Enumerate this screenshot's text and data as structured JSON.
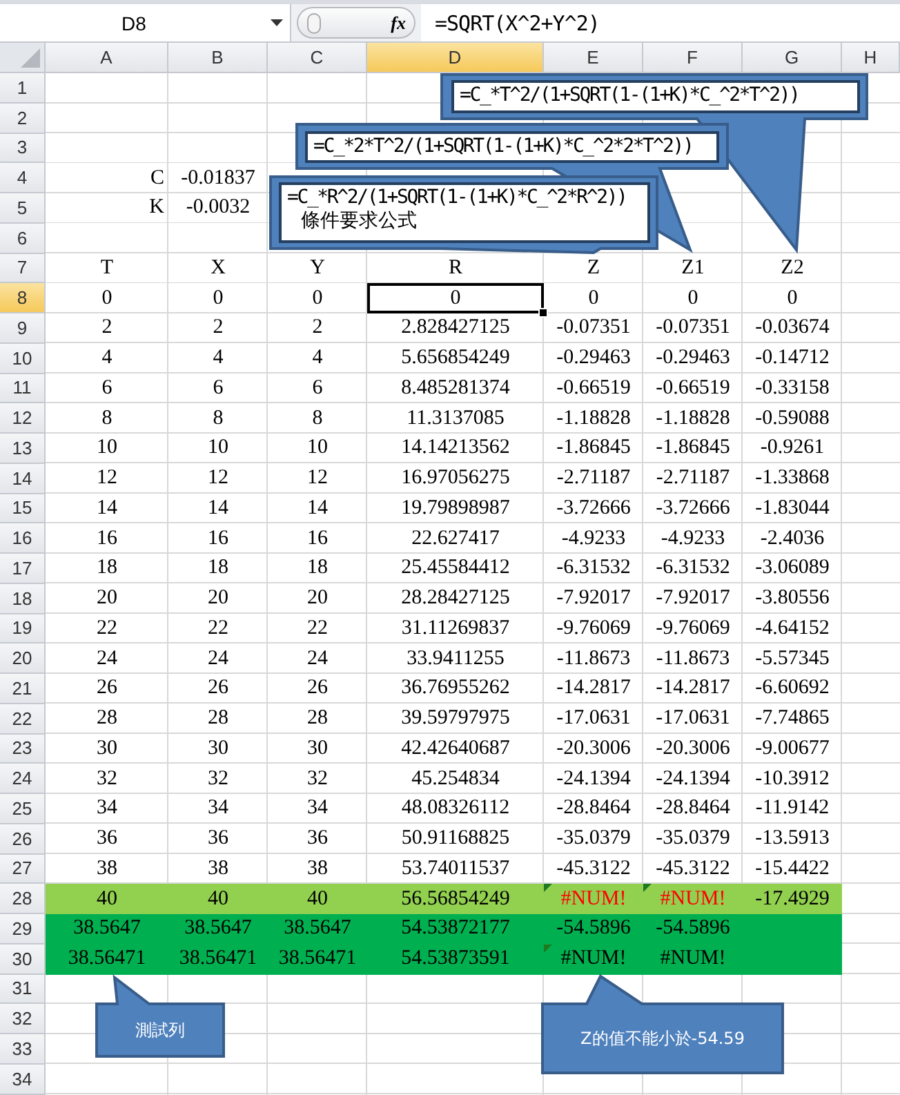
{
  "formula_bar": {
    "name_box": "D8",
    "function_button": "fx",
    "formula": "=SQRT(X^2+Y^2)"
  },
  "columns": [
    {
      "label": "A",
      "selected": false
    },
    {
      "label": "B",
      "selected": false
    },
    {
      "label": "C",
      "selected": false
    },
    {
      "label": "D",
      "selected": true
    },
    {
      "label": "E",
      "selected": false
    },
    {
      "label": "F",
      "selected": false
    },
    {
      "label": "G",
      "selected": false
    },
    {
      "label": "H",
      "selected": false
    }
  ],
  "rows": [
    {
      "number": "1",
      "selected": false,
      "cells": [
        null,
        null,
        null,
        null,
        null,
        null,
        null,
        null
      ]
    },
    {
      "number": "2",
      "selected": false,
      "cells": [
        null,
        null,
        null,
        null,
        null,
        null,
        null,
        null
      ]
    },
    {
      "number": "3",
      "selected": false,
      "cells": [
        null,
        null,
        null,
        null,
        null,
        null,
        null,
        null
      ]
    },
    {
      "number": "4",
      "selected": false,
      "cells": [
        {
          "text": "C",
          "kind": "label"
        },
        "-0.01837",
        null,
        null,
        null,
        null,
        null,
        null
      ]
    },
    {
      "number": "5",
      "selected": false,
      "cells": [
        {
          "text": "K",
          "kind": "label"
        },
        "-0.0032",
        null,
        null,
        null,
        null,
        null,
        null
      ]
    },
    {
      "number": "6",
      "selected": false,
      "cells": [
        null,
        null,
        null,
        null,
        null,
        null,
        null,
        null
      ]
    },
    {
      "number": "7",
      "selected": false,
      "cells": [
        "T",
        "X",
        "Y",
        "R",
        "Z",
        "Z1",
        "Z2",
        null
      ]
    },
    {
      "number": "8",
      "selected": true,
      "cells": [
        "0",
        "0",
        "0",
        {
          "text": "0",
          "selected": true
        },
        "0",
        "0",
        "0",
        null
      ]
    },
    {
      "number": "9",
      "selected": false,
      "cells": [
        "2",
        "2",
        "2",
        "2.828427125",
        "-0.07351",
        "-0.07351",
        "-0.03674",
        null
      ]
    },
    {
      "number": "10",
      "selected": false,
      "cells": [
        "4",
        "4",
        "4",
        "5.656854249",
        "-0.29463",
        "-0.29463",
        "-0.14712",
        null
      ]
    },
    {
      "number": "11",
      "selected": false,
      "cells": [
        "6",
        "6",
        "6",
        "8.485281374",
        "-0.66519",
        "-0.66519",
        "-0.33158",
        null
      ]
    },
    {
      "number": "12",
      "selected": false,
      "cells": [
        "8",
        "8",
        "8",
        "11.3137085",
        "-1.18828",
        "-1.18828",
        "-0.59088",
        null
      ]
    },
    {
      "number": "13",
      "selected": false,
      "cells": [
        "10",
        "10",
        "10",
        "14.14213562",
        "-1.86845",
        "-1.86845",
        "-0.9261",
        null
      ]
    },
    {
      "number": "14",
      "selected": false,
      "cells": [
        "12",
        "12",
        "12",
        "16.97056275",
        "-2.71187",
        "-2.71187",
        "-1.33868",
        null
      ]
    },
    {
      "number": "15",
      "selected": false,
      "cells": [
        "14",
        "14",
        "14",
        "19.79898987",
        "-3.72666",
        "-3.72666",
        "-1.83044",
        null
      ]
    },
    {
      "number": "16",
      "selected": false,
      "cells": [
        "16",
        "16",
        "16",
        "22.627417",
        "-4.9233",
        "-4.9233",
        "-2.4036",
        null
      ]
    },
    {
      "number": "17",
      "selected": false,
      "cells": [
        "18",
        "18",
        "18",
        "25.45584412",
        "-6.31532",
        "-6.31532",
        "-3.06089",
        null
      ]
    },
    {
      "number": "18",
      "selected": false,
      "cells": [
        "20",
        "20",
        "20",
        "28.28427125",
        "-7.92017",
        "-7.92017",
        "-3.80556",
        null
      ]
    },
    {
      "number": "19",
      "selected": false,
      "cells": [
        "22",
        "22",
        "22",
        "31.11269837",
        "-9.76069",
        "-9.76069",
        "-4.64152",
        null
      ]
    },
    {
      "number": "20",
      "selected": false,
      "cells": [
        "24",
        "24",
        "24",
        "33.9411255",
        "-11.8673",
        "-11.8673",
        "-5.57345",
        null
      ]
    },
    {
      "number": "21",
      "selected": false,
      "cells": [
        "26",
        "26",
        "26",
        "36.76955262",
        "-14.2817",
        "-14.2817",
        "-6.60692",
        null
      ]
    },
    {
      "number": "22",
      "selected": false,
      "cells": [
        "28",
        "28",
        "28",
        "39.59797975",
        "-17.0631",
        "-17.0631",
        "-7.74865",
        null
      ]
    },
    {
      "number": "23",
      "selected": false,
      "cells": [
        "30",
        "30",
        "30",
        "42.42640687",
        "-20.3006",
        "-20.3006",
        "-9.00677",
        null
      ]
    },
    {
      "number": "24",
      "selected": false,
      "cells": [
        "32",
        "32",
        "32",
        "45.254834",
        "-24.1394",
        "-24.1394",
        "-10.3912",
        null
      ]
    },
    {
      "number": "25",
      "selected": false,
      "cells": [
        "34",
        "34",
        "34",
        "48.08326112",
        "-28.8464",
        "-28.8464",
        "-11.9142",
        null
      ]
    },
    {
      "number": "26",
      "selected": false,
      "cells": [
        "36",
        "36",
        "36",
        "50.91168825",
        "-35.0379",
        "-35.0379",
        "-13.5913",
        null
      ]
    },
    {
      "number": "27",
      "selected": false,
      "cells": [
        "38",
        "38",
        "38",
        "53.74011537",
        "-45.3122",
        "-45.3122",
        "-15.4422",
        null
      ]
    },
    {
      "number": "28",
      "selected": false,
      "color": "#92d050",
      "cells": [
        "40",
        "40",
        "40",
        "56.56854249",
        {
          "text": "#NUM!",
          "kind": "error",
          "flagged": true
        },
        {
          "text": "#NUM!",
          "kind": "error",
          "flagged": true
        },
        "-17.4929",
        null
      ]
    },
    {
      "number": "29",
      "selected": false,
      "color": "#00b050",
      "cells": [
        "38.5647",
        "38.5647",
        "38.5647",
        "54.53872177",
        "-54.5896",
        "-54.5896",
        null,
        null
      ]
    },
    {
      "number": "30",
      "selected": false,
      "color": "#00b050",
      "cells": [
        "38.56471",
        "38.56471",
        "38.56471",
        "54.53873591",
        {
          "text": "#NUM!",
          "kind": "value",
          "flagged": true
        },
        "#NUM!",
        null,
        null
      ]
    },
    {
      "number": "31",
      "selected": false,
      "cells": [
        null,
        null,
        null,
        null,
        null,
        null,
        null,
        null
      ]
    },
    {
      "number": "32",
      "selected": false,
      "cells": [
        null,
        null,
        null,
        null,
        null,
        null,
        null,
        null
      ]
    },
    {
      "number": "33",
      "selected": false,
      "cells": [
        null,
        null,
        null,
        null,
        null,
        null,
        null,
        null
      ]
    },
    {
      "number": "34",
      "selected": false,
      "cells": [
        null,
        null,
        null,
        null,
        null,
        null,
        null,
        null
      ]
    }
  ],
  "callouts": [
    {
      "kind": "boxed",
      "lines": [
        "=C_*T^2/(1+SQRT(1-(1+K)*C_^2*T^2))"
      ]
    },
    {
      "kind": "boxed",
      "lines": [
        "=C_*2*T^2/(1+SQRT(1-(1+K)*C_^2*2*T^2))"
      ]
    },
    {
      "kind": "boxed",
      "lines": [
        "=C_*R^2/(1+SQRT(1-(1+K)*C_^2*R^2))",
        "條件要求公式"
      ]
    },
    {
      "kind": "plain",
      "lines": [
        "測試列"
      ]
    },
    {
      "kind": "plain",
      "lines": [
        "Z的值不能小於-54.59"
      ]
    }
  ]
}
